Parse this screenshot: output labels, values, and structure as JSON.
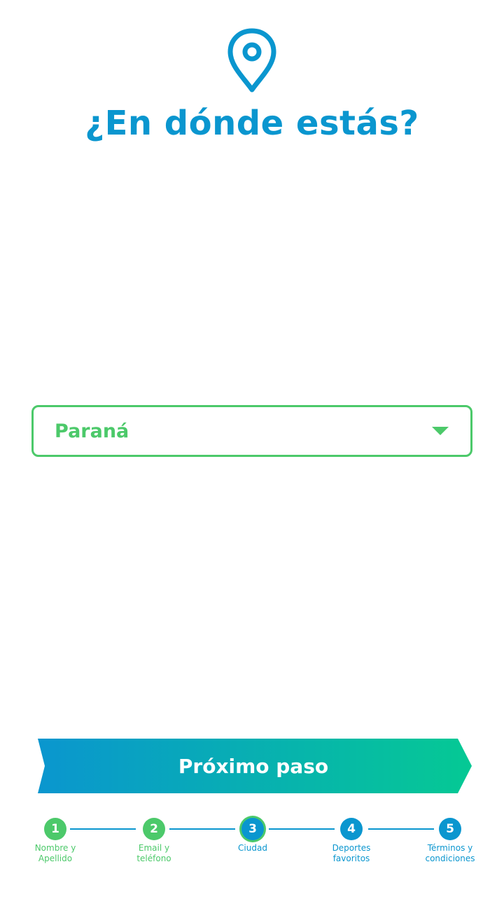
{
  "header": {
    "icon": "location-pin-icon",
    "title": "¿En dónde estás?"
  },
  "city_select": {
    "selected_value": "Paraná",
    "icon": "chevron-down-icon"
  },
  "next_button": {
    "label": "Próximo paso"
  },
  "stepper": {
    "current_step": 3,
    "steps": [
      {
        "number": "1",
        "label": "Nombre y\nApellido",
        "state": "done"
      },
      {
        "number": "2",
        "label": "Email y\nteléfono",
        "state": "done"
      },
      {
        "number": "3",
        "label": "Ciudad",
        "state": "current"
      },
      {
        "number": "4",
        "label": "Deportes\nfavoritos",
        "state": "todo"
      },
      {
        "number": "5",
        "label": "Términos y\ncondiciones",
        "state": "todo"
      }
    ]
  },
  "colors": {
    "primary_blue": "#0a96cf",
    "accent_green": "#4cc96a",
    "gradient_end": "#05c994"
  }
}
